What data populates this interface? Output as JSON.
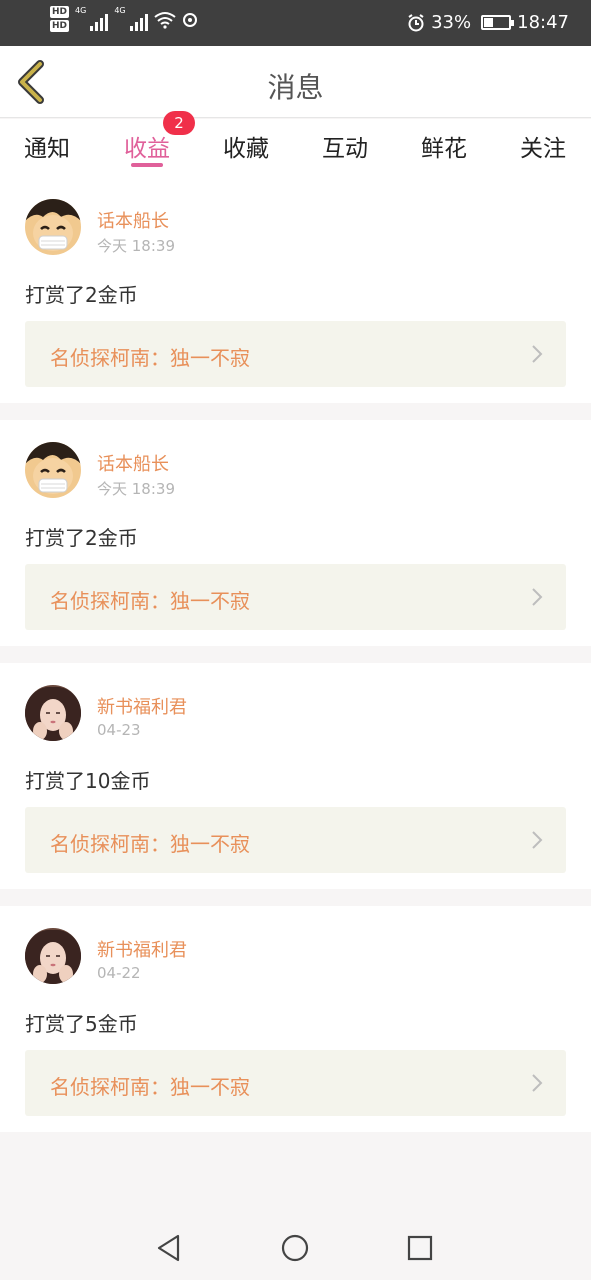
{
  "status_bar": {
    "hd1": "HD",
    "hd2": "HD",
    "net1": "4G",
    "net2": "4G",
    "battery_percent": "33%",
    "battery_level": 0.33,
    "time": "18:47",
    "icons": [
      "signal-icon",
      "wifi-icon",
      "sync-icon",
      "alarm-icon",
      "battery-icon"
    ]
  },
  "header": {
    "title": "消息",
    "back_icon": "chevron-left-icon"
  },
  "tabs": [
    {
      "label": "通知"
    },
    {
      "label": "收益",
      "badge": "2"
    },
    {
      "label": "收藏"
    },
    {
      "label": "互动"
    },
    {
      "label": "鲜花"
    },
    {
      "label": "关注"
    }
  ],
  "active_tab": "收益",
  "messages": [
    {
      "user": "话本船长",
      "time": "今天 18:39",
      "text": "打赏了2金币",
      "book": "名侦探柯南：独一不寂",
      "avatar": "anime-boy-avatar"
    },
    {
      "user": "话本船长",
      "time": "今天 18:39",
      "text": "打赏了2金币",
      "book": "名侦探柯南：独一不寂",
      "avatar": "anime-boy-avatar"
    },
    {
      "user": "新书福利君",
      "time": "04-23",
      "text": "打赏了10金币",
      "book": "名侦探柯南：独一不寂",
      "avatar": "girl-photo-avatar"
    },
    {
      "user": "新书福利君",
      "time": "04-22",
      "text": "打赏了5金币",
      "book": "名侦探柯南：独一不寂",
      "avatar": "girl-photo-avatar"
    }
  ],
  "colors": {
    "accent": "#e0609a",
    "name": "#e8905a",
    "badge": "#f0304a",
    "ref_bg": "#f4f4ec",
    "back_icon": "#c9b24a"
  },
  "nav": {
    "icons": [
      "back-triangle-icon",
      "home-circle-icon",
      "recents-square-icon"
    ]
  }
}
